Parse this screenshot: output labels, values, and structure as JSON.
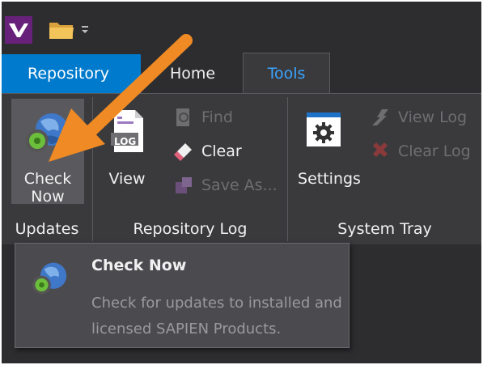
{
  "quick_access": {
    "app_logo_icon": "visual-studio-logo-icon",
    "folder_icon": "folder-icon",
    "dropdown_icon": "qat-dropdown-icon"
  },
  "tabs": [
    {
      "label": "Repository",
      "type": "application-menu",
      "color": "#007acc"
    },
    {
      "label": "Home",
      "active": false
    },
    {
      "label": "Tools",
      "active": true,
      "color": "#3aa4ff"
    }
  ],
  "ribbon": {
    "updates": {
      "group_label": "Updates",
      "check_now": {
        "label_line1": "Check",
        "label_line2": "Now",
        "icon": "globe-update-icon"
      }
    },
    "repository_log": {
      "group_label": "Repository Log",
      "view": {
        "label": "View",
        "icon": "log-file-icon"
      },
      "find": {
        "label": "Find",
        "icon": "find-icon",
        "enabled": false
      },
      "clear": {
        "label": "Clear",
        "icon": "eraser-icon",
        "enabled": true
      },
      "save_as": {
        "label": "Save As...",
        "icon": "save-as-icon",
        "enabled": false
      }
    },
    "system_tray": {
      "group_label": "System Tray",
      "settings": {
        "label": "Settings",
        "icon": "gear-icon"
      },
      "view_log": {
        "label": "View Log",
        "icon": "view-log-icon",
        "enabled": false
      },
      "clear_log": {
        "label": "Clear Log",
        "icon": "clear-log-icon",
        "enabled": false
      }
    }
  },
  "tooltip": {
    "title": "Check Now",
    "description": "Check for updates to installed and licensed SAPIEN Products.",
    "icon": "globe-update-icon"
  },
  "annotation": {
    "icon": "orange-pointer-arrow-icon",
    "color": "#f08a24"
  },
  "colors": {
    "background": "#2d2d30",
    "ribbon": "#3a3a3d",
    "accent_blue": "#007acc",
    "active_tab_text": "#3aa4ff",
    "disabled_text": "#6e6e70"
  }
}
